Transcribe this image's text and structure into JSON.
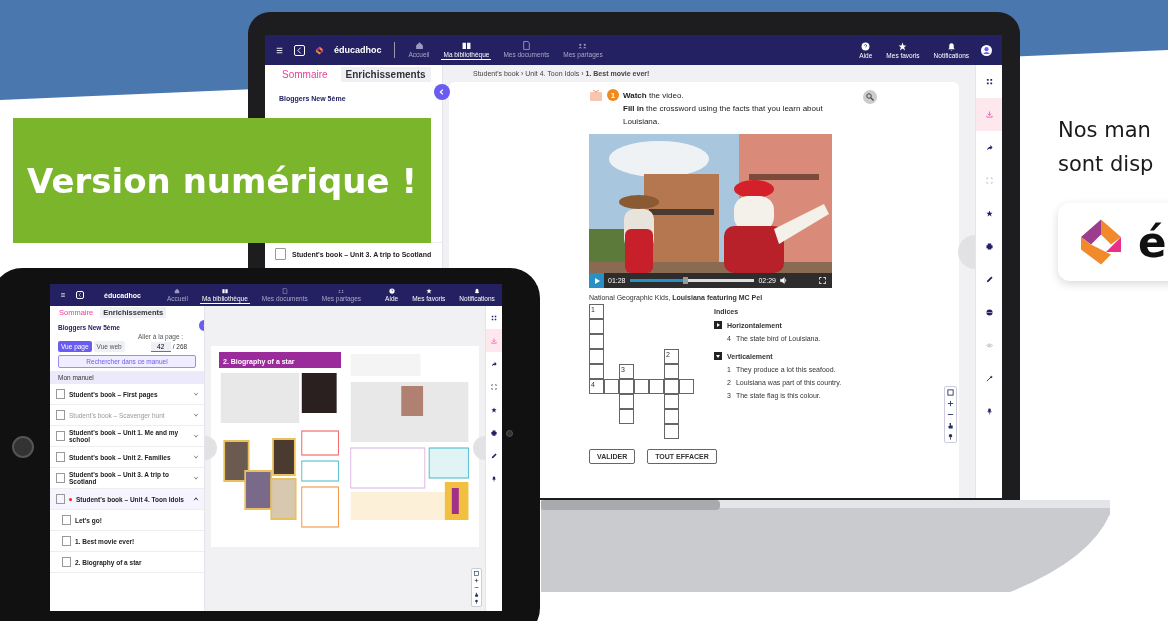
{
  "banner": {
    "text": "Version numérique !"
  },
  "promo": {
    "lines": [
      "Nos man",
      "sont disp"
    ],
    "logo_text": "é"
  },
  "laptop": {
    "nav": {
      "brand": "éducadhoc",
      "items": [
        {
          "label": "Accueil",
          "selected": false
        },
        {
          "label": "Ma bibliothèque",
          "selected": true
        },
        {
          "label": "Mes documents",
          "selected": false
        },
        {
          "label": "Mes partages",
          "selected": false
        }
      ],
      "actions": [
        "Aide",
        "Mes favoris",
        "Notifications"
      ]
    },
    "sidebar": {
      "tabs": [
        {
          "label": "Sommaire",
          "selected": true
        },
        {
          "label": "Enrichissements",
          "selected": false
        }
      ],
      "book_title": "Bloggers New 5ème",
      "items": [
        {
          "label": "Student's book – Unit 3. A trip to Scotland"
        }
      ]
    },
    "breadcrumb": {
      "path": "Student's book › Unit 4. Toon Idols ›",
      "current": "1. Best movie ever!"
    },
    "exercise": {
      "number": "1",
      "instructions": [
        "**Watch** the video.",
        "**Fill in** the crossword using the facts that you learn about Louisiana."
      ]
    },
    "video": {
      "elapsed": "01:28",
      "duration": "02:29",
      "level": 0.43,
      "caption": "National Geographic Kids, **Louisiana featuring MC Pel**"
    },
    "crossword": {
      "numbers": [
        "1",
        "2",
        "3",
        "4"
      ]
    },
    "clues": {
      "title": "Indices",
      "groups": [
        {
          "kind": "across",
          "heading": "Horizontalement",
          "items": [
            {
              "number": "4",
              "text": "The state bird of Louisiana."
            }
          ]
        },
        {
          "kind": "down",
          "heading": "Verticalement",
          "items": [
            {
              "number": "1",
              "text": "They produce a lot this seafood."
            },
            {
              "number": "2",
              "text": "Louisiana was part of this country."
            },
            {
              "number": "3",
              "text": "The state flag is this colour."
            }
          ]
        }
      ]
    },
    "buttons": [
      "VALIDER",
      "TOUT EFFACER"
    ],
    "tools": [
      {
        "selected": false,
        "disabled": false
      },
      {
        "selected": true,
        "disabled": false
      },
      {
        "selected": false,
        "disabled": false
      },
      {
        "selected": false,
        "disabled": true
      },
      {
        "selected": false,
        "disabled": false
      },
      {
        "selected": false,
        "disabled": false
      },
      {
        "selected": false,
        "disabled": false
      },
      {
        "selected": false,
        "disabled": false
      },
      {
        "selected": false,
        "disabled": true
      },
      {
        "selected": false,
        "disabled": false
      },
      {
        "selected": false,
        "disabled": false
      }
    ]
  },
  "tablet": {
    "nav": {
      "brand": "éducadhoc",
      "items": [
        {
          "label": "Accueil",
          "selected": false
        },
        {
          "label": "Ma bibliothèque",
          "selected": true
        },
        {
          "label": "Mes documents",
          "selected": false
        },
        {
          "label": "Mes partages",
          "selected": false
        }
      ],
      "actions": [
        "Aide",
        "Mes favoris",
        "Notifications"
      ]
    },
    "sidebar": {
      "tabs": [
        {
          "label": "Sommaire",
          "selected": true
        },
        {
          "label": "Enrichissements",
          "selected": false
        }
      ],
      "book_title": "Bloggers New 5ème",
      "goto_label": "Aller à la page :",
      "views": [
        {
          "label": "Vue page",
          "selected": true
        },
        {
          "label": "Vue web",
          "selected": false
        }
      ],
      "page_value": "42",
      "page_total": "/ 268",
      "search_button": "Rechercher dans ce manuel",
      "section": "Mon manuel",
      "items": [
        {
          "label": "Student's book – First pages",
          "current": false,
          "expanded": false,
          "disabled": false
        },
        {
          "label": "Student's book – Scavenger hunt",
          "current": false,
          "expanded": false,
          "disabled": true
        },
        {
          "label": "Student's book – Unit 1. Me and my school",
          "current": false,
          "expanded": false,
          "disabled": false
        },
        {
          "label": "Student's book – Unit 2. Families",
          "current": false,
          "expanded": false,
          "disabled": false
        },
        {
          "label": "Student's book – Unit 3. A trip to Scotland",
          "current": false,
          "expanded": false,
          "disabled": false
        },
        {
          "label": "Student's book – Unit 4. Toon Idols",
          "current": true,
          "expanded": true,
          "disabled": false,
          "children": [
            {
              "label": "Let's go!"
            },
            {
              "label": "1. Best movie ever!"
            },
            {
              "label": "2. Biography of a star"
            }
          ]
        }
      ]
    },
    "page_title": "2. Biography of a star",
    "tools": [
      {
        "selected": false
      },
      {
        "selected": true
      },
      {
        "selected": false
      },
      {
        "selected": false
      },
      {
        "selected": false
      },
      {
        "selected": false
      },
      {
        "selected": false
      },
      {
        "selected": false
      }
    ]
  }
}
